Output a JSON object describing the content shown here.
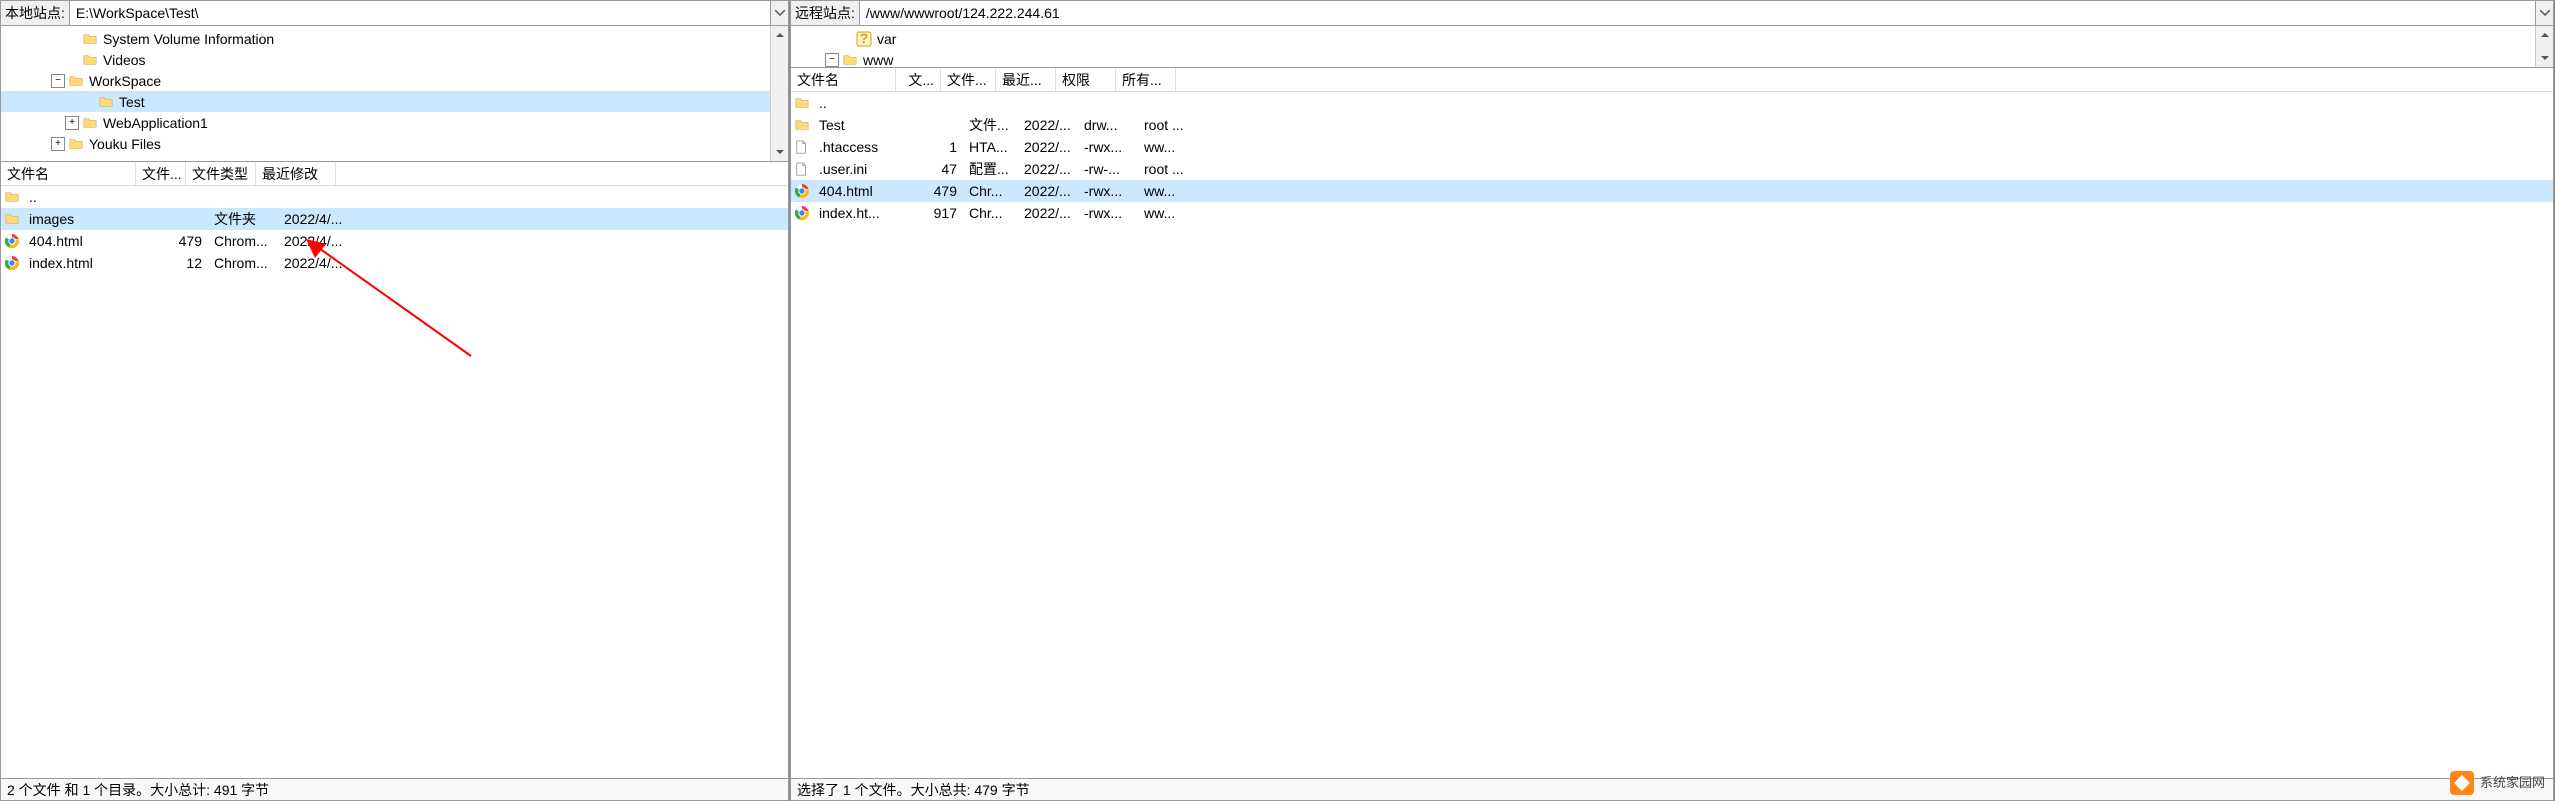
{
  "local": {
    "site_label": "本地站点:",
    "path": "E:\\WorkSpace\\Test\\",
    "tree": [
      {
        "indent": 56,
        "toggle": "",
        "icon": "folder",
        "label": "System Volume Information"
      },
      {
        "indent": 56,
        "toggle": "",
        "icon": "folder",
        "label": "Videos"
      },
      {
        "indent": 42,
        "toggle": "minus",
        "icon": "folder",
        "label": "WorkSpace"
      },
      {
        "indent": 72,
        "toggle": "",
        "icon": "folder",
        "label": "Test",
        "selected": true
      },
      {
        "indent": 56,
        "toggle": "plus",
        "icon": "folder",
        "label": "WebApplication1"
      },
      {
        "indent": 42,
        "toggle": "plus",
        "icon": "folder",
        "label": "Youku Files"
      }
    ],
    "columns": {
      "name": "文件名",
      "size": "文件...",
      "type": "文件类型",
      "date": "最近修改"
    },
    "files": [
      {
        "icon": "folder",
        "name": "..",
        "size": "",
        "type": "",
        "date": ""
      },
      {
        "icon": "folder",
        "name": "images",
        "size": "",
        "type": "文件夹",
        "date": "2022/4/...",
        "selected": true
      },
      {
        "icon": "chrome",
        "name": "404.html",
        "size": "479",
        "type": "Chrom...",
        "date": "2022/4/..."
      },
      {
        "icon": "chrome",
        "name": "index.html",
        "size": "12",
        "type": "Chrom...",
        "date": "2022/4/..."
      }
    ],
    "status": "2 个文件 和 1 个目录。大小总计: 491 字节"
  },
  "remote": {
    "site_label": "远程站点:",
    "path": "/www/wwwroot/124.222.244.61",
    "tree": [
      {
        "indent": 40,
        "toggle": "",
        "icon": "question",
        "label": "var"
      },
      {
        "indent": 26,
        "toggle": "minus",
        "icon": "folder",
        "label": "www"
      }
    ],
    "columns": {
      "name": "文件名",
      "size": "文...",
      "type": "文件...",
      "date": "最近...",
      "perm": "权限",
      "own": "所有..."
    },
    "files": [
      {
        "icon": "folder",
        "name": "..",
        "size": "",
        "type": "",
        "date": "",
        "perm": "",
        "own": ""
      },
      {
        "icon": "folder",
        "name": "Test",
        "size": "",
        "type": "文件...",
        "date": "2022/...",
        "perm": "drw...",
        "own": "root ..."
      },
      {
        "icon": "file",
        "name": ".htaccess",
        "size": "1",
        "type": "HTA...",
        "date": "2022/...",
        "perm": "-rwx...",
        "own": "ww..."
      },
      {
        "icon": "file",
        "name": ".user.ini",
        "size": "47",
        "type": "配置...",
        "date": "2022/...",
        "perm": "-rw-...",
        "own": "root ..."
      },
      {
        "icon": "chrome",
        "name": "404.html",
        "size": "479",
        "type": "Chr...",
        "date": "2022/...",
        "perm": "-rwx...",
        "own": "ww...",
        "selected": true
      },
      {
        "icon": "chrome",
        "name": "index.ht...",
        "size": "917",
        "type": "Chr...",
        "date": "2022/...",
        "perm": "-rwx...",
        "own": "ww..."
      }
    ],
    "status": "选择了 1 个文件。大小总共: 479 字节"
  },
  "watermark": "系统家园网"
}
